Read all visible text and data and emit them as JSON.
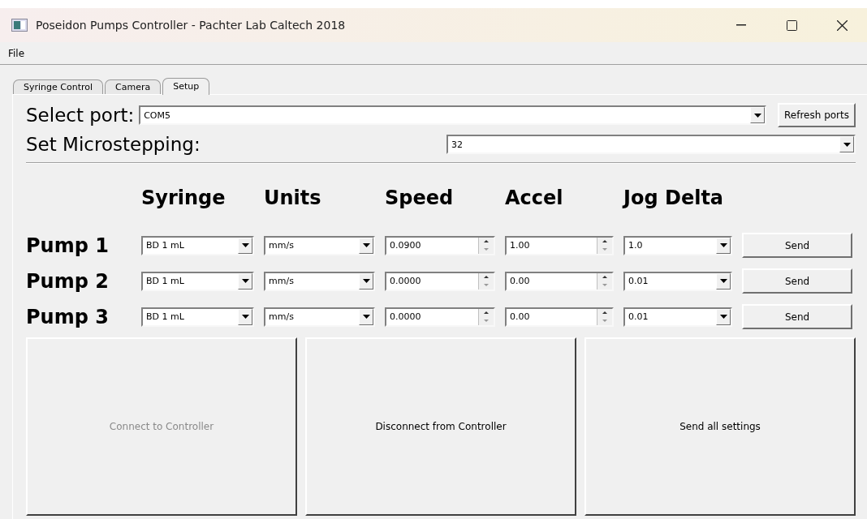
{
  "window": {
    "title": "Poseidon Pumps Controller - Pachter Lab Caltech 2018"
  },
  "menu": [
    "File"
  ],
  "tabs": [
    {
      "label": "Syringe Control",
      "selected": false
    },
    {
      "label": "Camera",
      "selected": false
    },
    {
      "label": "Setup",
      "selected": true
    }
  ],
  "port": {
    "label": "Select port:",
    "value": "COM5",
    "button": "Refresh ports"
  },
  "microstepping": {
    "label": "Set Microstepping:",
    "value": "32"
  },
  "columns": [
    "Syringe",
    "Units",
    "Speed",
    "Accel",
    "Jog Delta"
  ],
  "pumps": [
    {
      "name": "Pump 1",
      "syringe": "BD 1 mL",
      "units": "mm/s",
      "speed": "0.0900",
      "accel": "1.00",
      "jog_delta": "1.0",
      "button": "Send"
    },
    {
      "name": "Pump 2",
      "syringe": "BD 1 mL",
      "units": "mm/s",
      "speed": "0.0000",
      "accel": "0.00",
      "jog_delta": "0.01",
      "button": "Send"
    },
    {
      "name": "Pump 3",
      "syringe": "BD 1 mL",
      "units": "mm/s",
      "speed": "0.0000",
      "accel": "0.00",
      "jog_delta": "0.01",
      "button": "Send"
    }
  ],
  "actions": [
    {
      "label": "Connect to Controller",
      "disabled": true
    },
    {
      "label": "Disconnect from Controller",
      "disabled": false
    },
    {
      "label": "Send all settings",
      "disabled": false
    }
  ]
}
